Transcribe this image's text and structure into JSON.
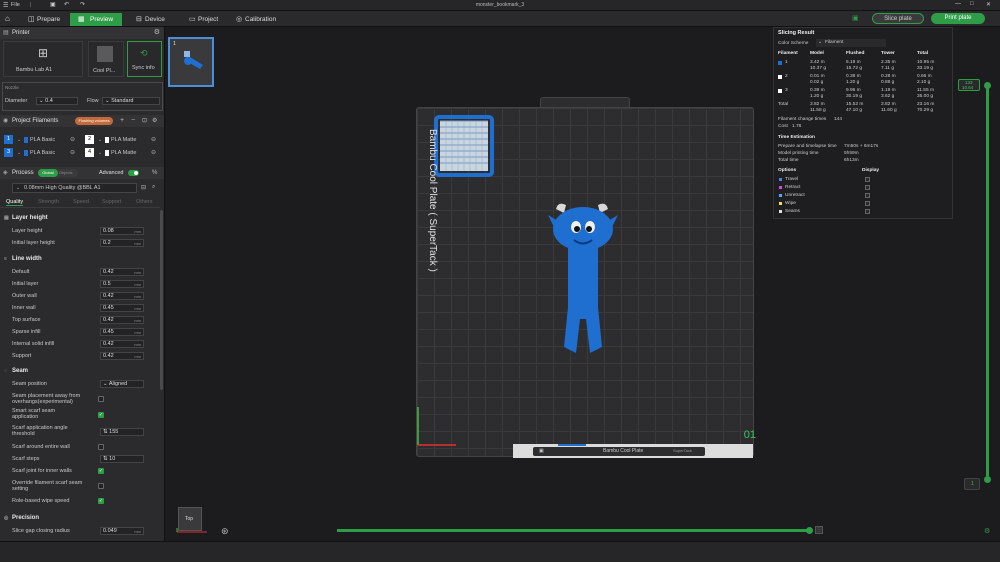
{
  "titlebar": {
    "menu": "File",
    "title": "monster_bookmark_3"
  },
  "tabs": {
    "prepare": "Prepare",
    "preview": "Preview",
    "device": "Device",
    "project": "Project",
    "calibration": "Calibration"
  },
  "actions": {
    "slice_plate": "Slice plate",
    "print_plate": "Print plate"
  },
  "printer": {
    "header": "Printer",
    "name": "Bambu Lab A1",
    "plate": "Cool Pl...",
    "sync": "Sync info",
    "nozzle_label": "Nozzle",
    "diameter_label": "Diameter",
    "diameter_value": "0.4",
    "flow_label": "Flow",
    "flow_value": "Standard"
  },
  "filaments": {
    "header": "Project Filaments",
    "badge": "Flushing volumes",
    "items": [
      {
        "num": "1",
        "name": "PLA Basic",
        "color": "#1e6fd0"
      },
      {
        "num": "2",
        "name": "PLA Matte",
        "color": "#ffffff"
      },
      {
        "num": "3",
        "name": "PLA Basic",
        "color": "#1e6fd0"
      },
      {
        "num": "4",
        "name": "PLA Matte",
        "color": "#ffffff"
      }
    ]
  },
  "process": {
    "header": "Process",
    "global": "Global",
    "objects": "Objects",
    "advanced": "Advanced",
    "preset": "0.08mm High Quality @BBL A1",
    "tabs": [
      "Quality",
      "Strength",
      "Speed",
      "Support",
      "Others"
    ]
  },
  "settings": {
    "layer_height": {
      "title": "Layer height",
      "rows": [
        {
          "label": "Layer height",
          "value": "0.08",
          "unit": "mm"
        },
        {
          "label": "Initial layer height",
          "value": "0.2",
          "unit": "mm"
        }
      ]
    },
    "line_width": {
      "title": "Line width",
      "rows": [
        {
          "label": "Default",
          "value": "0.42",
          "unit": "mm"
        },
        {
          "label": "Initial layer",
          "value": "0.5",
          "unit": "mm"
        },
        {
          "label": "Outer wall",
          "value": "0.42",
          "unit": "mm"
        },
        {
          "label": "Inner wall",
          "value": "0.45",
          "unit": "mm"
        },
        {
          "label": "Top surface",
          "value": "0.42",
          "unit": "mm"
        },
        {
          "label": "Sparse infill",
          "value": "0.45",
          "unit": "mm"
        },
        {
          "label": "Internal solid infill",
          "value": "0.42",
          "unit": "mm"
        },
        {
          "label": "Support",
          "value": "0.42",
          "unit": "mm"
        }
      ]
    },
    "seam": {
      "title": "Seam",
      "position_label": "Seam position",
      "position_value": "Aligned",
      "overhangs_label": "Seam placement away from overhangs(experimental)",
      "smart_scarf_label": "Smart scarf seam application",
      "angle_label": "Scarf application angle threshold",
      "angle_value": "155",
      "around_label": "Scarf around entire wall",
      "steps_label": "Scarf steps",
      "steps_value": "10",
      "inner_label": "Scarf joint for inner walls",
      "override_label": "Override filament scarf seam setting",
      "wipe_label": "Role-based wipe speed"
    },
    "precision": {
      "title": "Precision",
      "gap_label": "Slice gap closing radius",
      "gap_value": "0.049",
      "gap_unit": "mm"
    }
  },
  "plate": {
    "number": "1",
    "label": "Bambu Cool Plate",
    "sublabel": "SuperTack",
    "side_text": "Bambu Cool Plate ( SuperTack )",
    "object_num": "01",
    "view_label": "Top"
  },
  "layer_slider": {
    "top": "133",
    "top_height": "10.64",
    "bottom": "1"
  },
  "slicing": {
    "title": "Slicing Result",
    "scheme_label": "Color Scheme",
    "scheme_value": "Filament",
    "cols": [
      "Filament",
      "Model",
      "Flushed",
      "Tower",
      "Total"
    ],
    "rows": [
      {
        "id": "1",
        "color": "#1e6fd0",
        "model": [
          "3.42 m",
          "10.37 g"
        ],
        "flushed": [
          "5.19 m",
          "15.72 g"
        ],
        "tower": [
          "2.35 m",
          "7.11 g"
        ],
        "total": [
          "10.95 m",
          "33.19 g"
        ]
      },
      {
        "id": "2",
        "color": "#ffffff",
        "model": [
          "0.01 m",
          "0.02 g"
        ],
        "flushed": [
          "0.38 m",
          "1.20 g"
        ],
        "tower": [
          "0.28 m",
          "0.88 g"
        ],
        "total": [
          "0.66 m",
          "2.10 g"
        ]
      },
      {
        "id": "3",
        "color": "#ffffff",
        "model": [
          "0.39 m",
          "1.20 g"
        ],
        "flushed": [
          "9.96 m",
          "30.19 g"
        ],
        "tower": [
          "1.19 m",
          "3.62 g"
        ],
        "total": [
          "11.55 m",
          "35.00 g"
        ]
      },
      {
        "id": "Total",
        "color": "",
        "model": [
          "3.82 m",
          "11.58 g"
        ],
        "flushed": [
          "15.52 m",
          "47.10 g"
        ],
        "tower": [
          "3.82 m",
          "11.60 g"
        ],
        "total": [
          "23.16 m",
          "70.29 g"
        ]
      }
    ],
    "changes_label": "Filament change times",
    "changes_value": "144",
    "cost_label": "Cost",
    "cost_value": "1.76",
    "time_title": "Time Estimation",
    "prepare_label": "Prepare and timelapse time",
    "prepare_value": "7m50s + 6m17s",
    "model_time_label": "Model printing time",
    "model_time_value": "5h59m",
    "total_time_label": "Total time",
    "total_time_value": "6h13m",
    "options_title": "Options",
    "display_title": "Display",
    "options": [
      {
        "name": "Travel",
        "color": "#4a80f0"
      },
      {
        "name": "Retract",
        "color": "#e040e0"
      },
      {
        "name": "Unretract",
        "color": "#40b0f0"
      },
      {
        "name": "Wipe",
        "color": "#f0e040"
      },
      {
        "name": "Seams",
        "color": "#e0e0e0"
      }
    ]
  }
}
